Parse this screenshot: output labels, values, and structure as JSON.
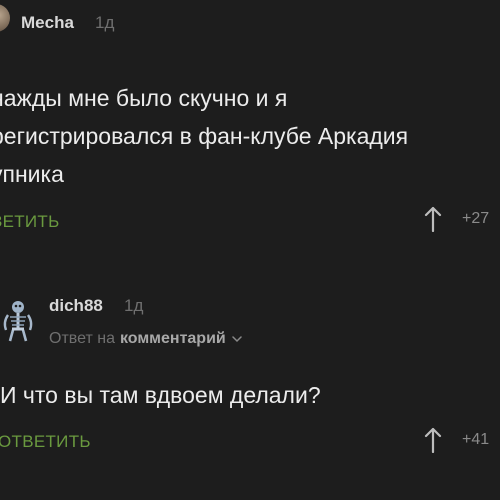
{
  "comments": [
    {
      "author": "Mecha",
      "time": "1д",
      "body": "нажды мне было скучно и я\nрегистрировался в фан-клубе Аркадия\nупника",
      "reply_label": "ЗЕТИТЬ",
      "votes": "+27",
      "avatar_icon": "user-avatar"
    },
    {
      "author": "dich88",
      "time": "1д",
      "reply_prefix": "Ответ на",
      "reply_target": "комментарий",
      "body": "И что вы там вдвоем делали?",
      "reply_label": "ОТВЕТИТЬ",
      "votes": "+41",
      "avatar_icon": "skeleton-avatar"
    }
  ],
  "colors": {
    "background": "#1d1d1d",
    "reply_accent": "#6a9a3f",
    "muted": "#6f6f6f"
  }
}
